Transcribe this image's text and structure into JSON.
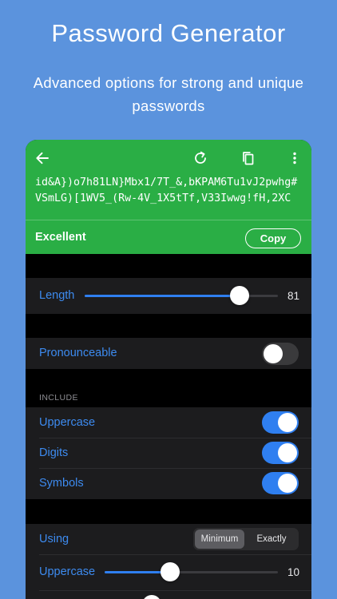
{
  "promo": {
    "title": "Password Generator",
    "subtitle": "Advanced options for strong and unique passwords"
  },
  "toolbar": {
    "back_icon": "arrow-left-icon",
    "refresh_icon": "refresh-icon",
    "copy_icon": "copy-icon",
    "more_icon": "more-vert-icon"
  },
  "password": "id&A})o7h81LN}Mbx1/7T_&,bKPAM6Tu1vJ2pwhg#VSmLG)[1WV5_(Rw-4V_1X5tTf,V33Iwwg!fH,2XC",
  "strength": {
    "label": "Excellent",
    "copy_label": "Copy"
  },
  "length": {
    "label": "Length",
    "value": "81",
    "fraction": 0.8
  },
  "pronounceable": {
    "label": "Pronounceable",
    "on": false
  },
  "include": {
    "header": "INCLUDE",
    "options": [
      {
        "label": "Uppercase",
        "on": true
      },
      {
        "label": "Digits",
        "on": true
      },
      {
        "label": "Symbols",
        "on": true
      }
    ]
  },
  "using": {
    "label": "Using",
    "segments": [
      "Minimum",
      "Exactly"
    ],
    "selected": "Minimum"
  },
  "min_uppercase": {
    "label": "Uppercase",
    "value": "10",
    "fraction": 0.38
  },
  "colors": {
    "background": "#5b93dd",
    "header_green": "#2aae45",
    "accent_blue": "#2f7ff0",
    "label_blue": "#3d8bf0",
    "row_bg": "#1c1c1e"
  }
}
